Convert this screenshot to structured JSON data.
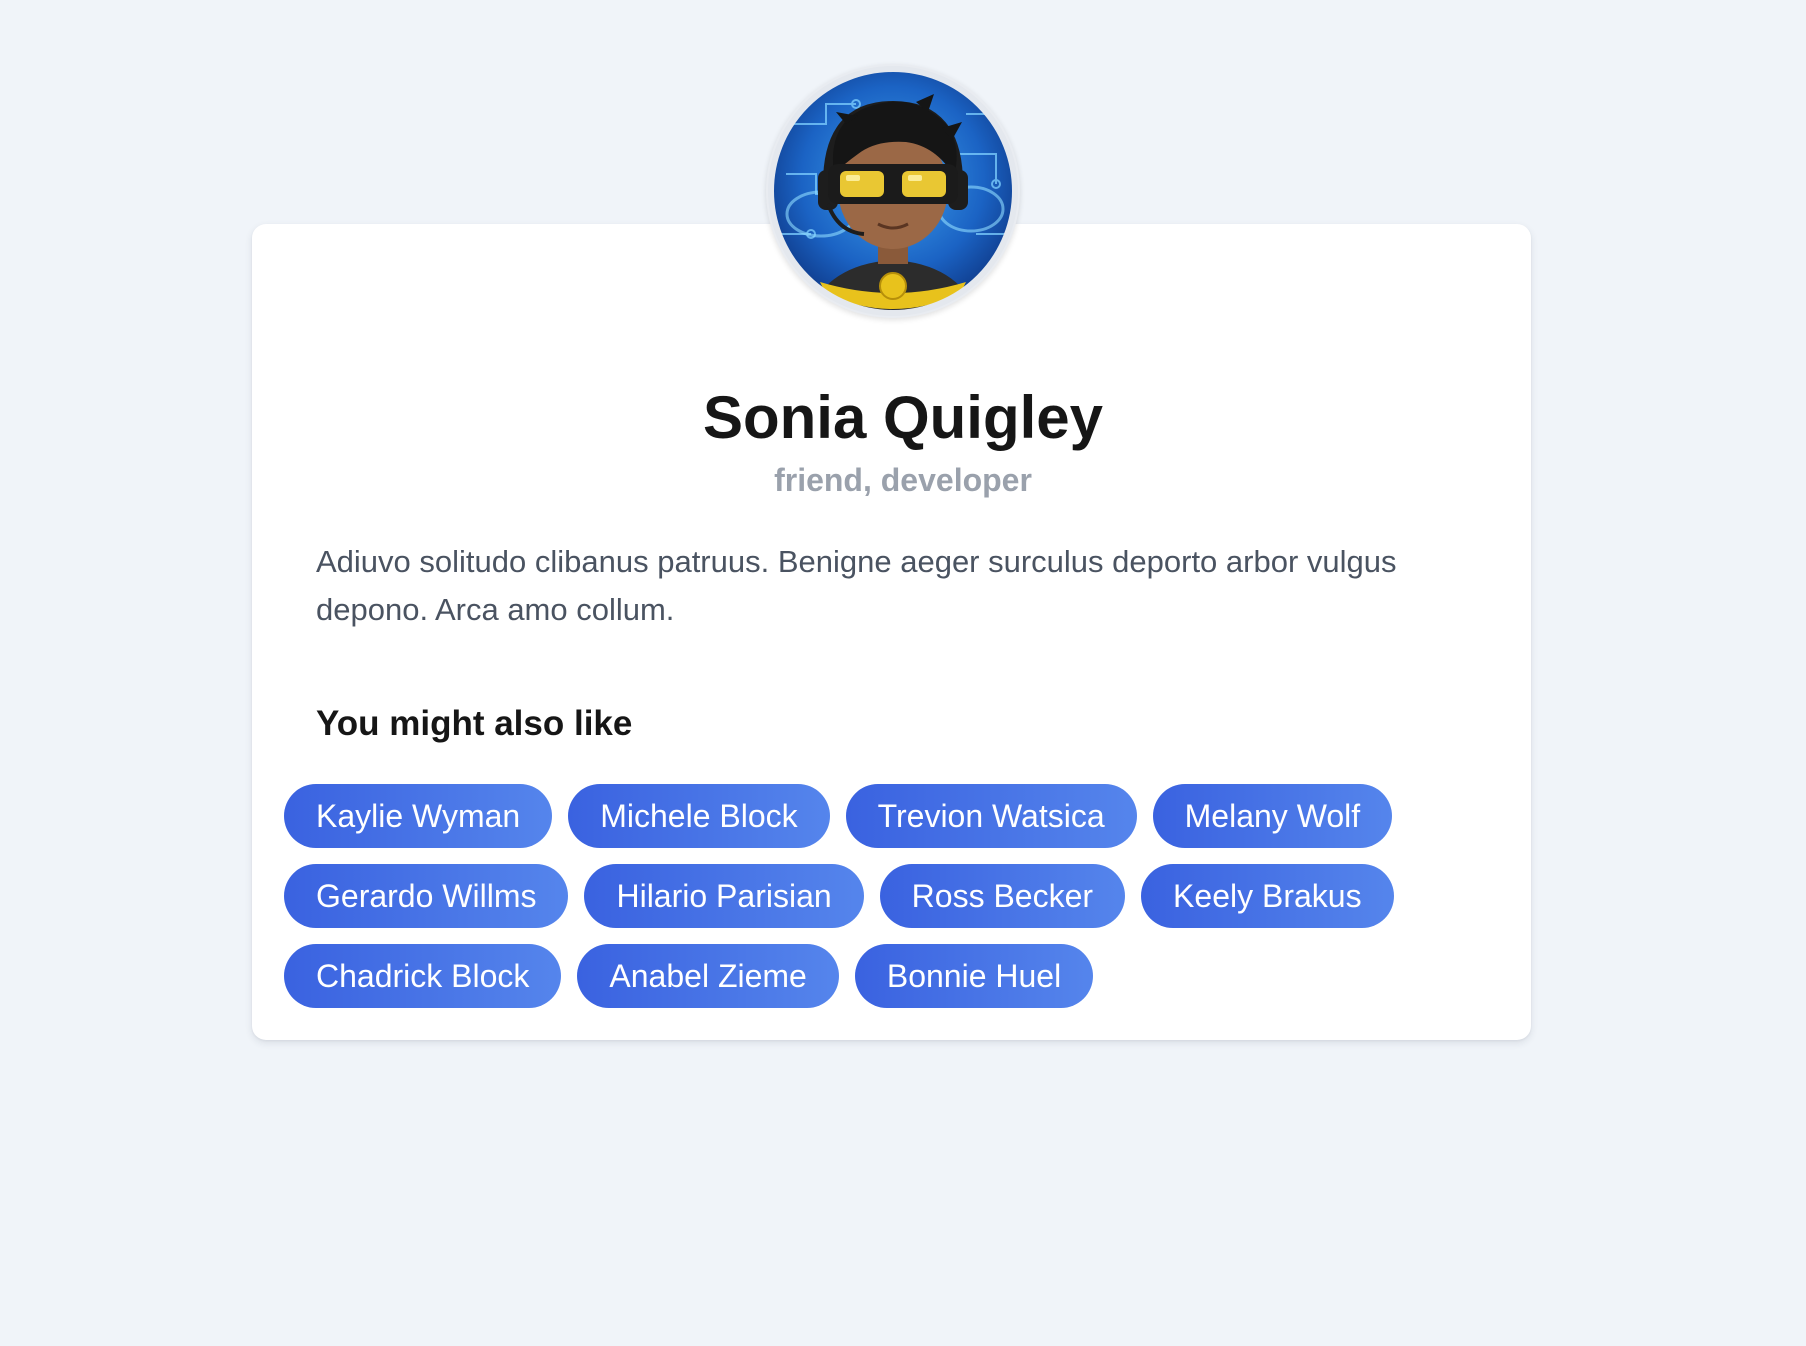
{
  "profile": {
    "name": "Sonia Quigley",
    "tags": "friend, developer",
    "bio": "Adiuvo solitudo clibanus patruus. Benigne aeger surculus deporto arbor vulgus depono. Arca amo collum.",
    "avatar_icon": "avatar-icon"
  },
  "recommendations": {
    "title": "You might also like",
    "people": [
      "Kaylie Wyman",
      "Michele Block",
      "Trevion Watsica",
      "Melany Wolf",
      "Gerardo Willms",
      "Hilario Parisian",
      "Ross Becker",
      "Keely Brakus",
      "Chadrick Block",
      "Anabel Zieme",
      "Bonnie Huel"
    ]
  },
  "colors": {
    "page_background": "#f0f4f9",
    "card_background": "#ffffff",
    "chip_gradient_start": "#3a62e0",
    "chip_gradient_end": "#5585ec",
    "name_text": "#161616",
    "tags_text": "#9aa1ac",
    "bio_text": "#4a5361"
  }
}
